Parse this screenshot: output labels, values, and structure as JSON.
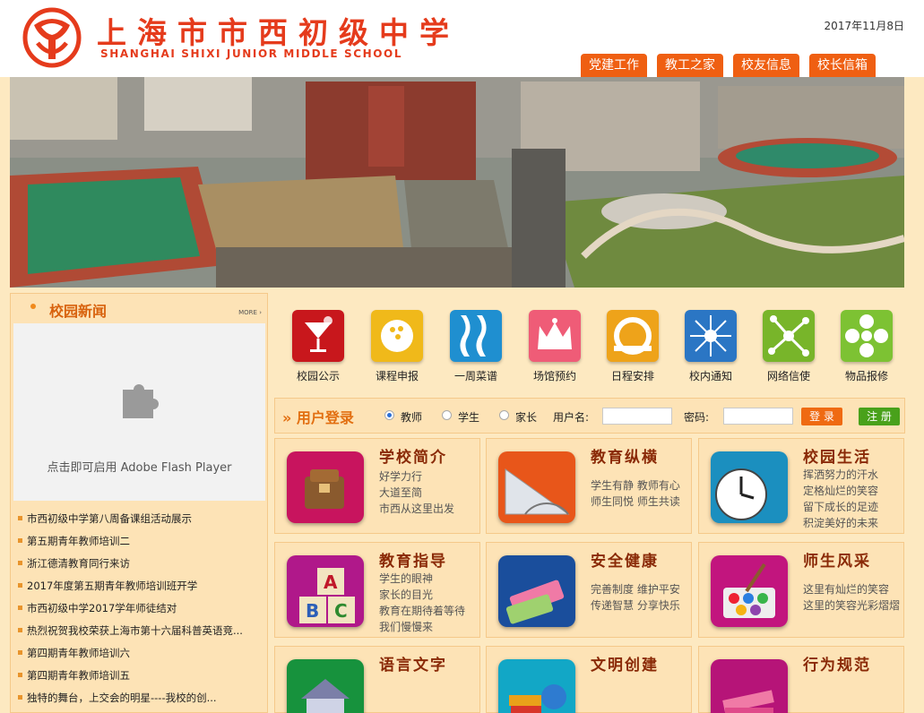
{
  "header": {
    "title_cn": "上海市市西初级中学",
    "title_en": "SHANGHAI SHIXI JUNIOR MIDDLE SCHOOL",
    "date": "2017年11月8日",
    "nav": [
      "党建工作",
      "教工之家",
      "校友信息",
      "校长信箱"
    ]
  },
  "news": {
    "title": "校园新闻",
    "more": "MORE",
    "flash_text": "点击即可启用 Adobe Flash Player",
    "items": [
      "市西初级中学第八周备课组活动展示",
      "第五期青年教师培训二",
      "浙江德清教育同行来访",
      "2017年度第五期青年教师培训班开学",
      "市西初级中学2017学年师徒结对",
      "热烈祝贺我校荣获上海市第十六届科普英语竞...",
      "第四期青年教师培训六",
      "第四期青年教师培训五",
      "独特的舞台，上交会的明星----我校的创..."
    ]
  },
  "quick_links": [
    {
      "label": "校园公示",
      "icon": "cocktail-icon",
      "color": "#c8171c"
    },
    {
      "label": "课程申报",
      "icon": "bowling-icon",
      "color": "#f0b91a"
    },
    {
      "label": "一周菜谱",
      "icon": "vase-icon",
      "color": "#1f8fd0"
    },
    {
      "label": "场馆预约",
      "icon": "crown-icon",
      "color": "#ef5c77"
    },
    {
      "label": "日程安排",
      "icon": "ring-icon",
      "color": "#eea31a"
    },
    {
      "label": "校内通知",
      "icon": "burst-icon",
      "color": "#2b76c4"
    },
    {
      "label": "网络信使",
      "icon": "network-icon",
      "color": "#78b52a"
    },
    {
      "label": "物品报修",
      "icon": "flower-icon",
      "color": "#7dc233"
    }
  ],
  "login": {
    "title": "用户登录",
    "roles": [
      "教师",
      "学生",
      "家长"
    ],
    "selected_role": "教师",
    "username_label": "用户名:",
    "password_label": "密码:",
    "login_button": "登 录",
    "register_button": "注 册"
  },
  "cards": [
    {
      "title": "学校简介",
      "lines": [
        "好学力行",
        "大道至简",
        "市西从这里出发"
      ],
      "color": "#c8145e"
    },
    {
      "title": "教育纵横",
      "lines": [
        "学生有静   教师有心",
        "师生同悦   师生共读"
      ],
      "color": "#e8561a"
    },
    {
      "title": "校园生活",
      "lines": [
        "挥洒努力的汗水",
        "定格灿烂的笑容",
        "留下成长的足迹",
        "积淀美好的未来"
      ],
      "color": "#1b8fbf"
    },
    {
      "title": "教育指导",
      "lines": [
        "学生的眼神",
        "家长的目光",
        "教育在期待着等待",
        "我们慢慢来"
      ],
      "color": "#b0188a"
    },
    {
      "title": "安全健康",
      "lines": [
        "完善制度   维护平安",
        "传递智慧   分享快乐"
      ],
      "color": "#1a4e9c"
    },
    {
      "title": "师生风采",
      "lines": [
        "这里有灿烂的笑容",
        "这里的笑容光彩熠熠"
      ],
      "color": "#c2157e"
    },
    {
      "title": "语言文字",
      "lines": [],
      "color": "#17923d"
    },
    {
      "title": "文明创建",
      "lines": [],
      "color": "#12a7c6"
    },
    {
      "title": "行为规范",
      "lines": [],
      "color": "#b61478"
    }
  ]
}
